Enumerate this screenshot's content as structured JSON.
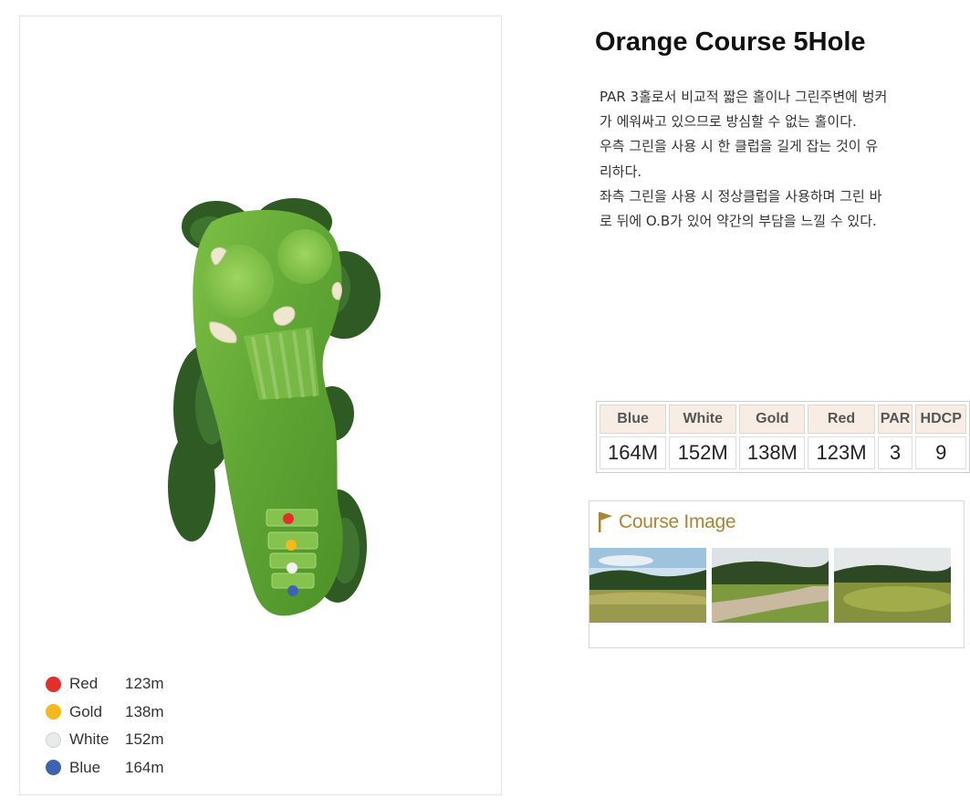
{
  "hole": {
    "title": "Orange Course 5Hole",
    "description": [
      "PAR 3홀로서 비교적 짧은 홀이나 그린주변에 벙커",
      "가 에워싸고 있으므로 방심할 수 없는 홀이다.",
      "우측 그린을 사용 시 한 클럽을 길게 잡는 것이 유",
      "리하다.",
      "좌측 그린을 사용 시 정상클럽을 사용하며 그린 바",
      "로 뒤에 O.B가 있어 약간의 부담을 느낄 수 있다."
    ]
  },
  "legend": [
    {
      "name": "Red",
      "distance": "123m",
      "color": "#e0302a"
    },
    {
      "name": "Gold",
      "distance": "138m",
      "color": "#f5b820"
    },
    {
      "name": "White",
      "distance": "152m",
      "color": "#e8ebeb"
    },
    {
      "name": "Blue",
      "distance": "164m",
      "color": "#3e63b0"
    }
  ],
  "scorecard": {
    "headers": [
      "Blue",
      "White",
      "Gold",
      "Red",
      "PAR",
      "HDCP"
    ],
    "values": [
      "164M",
      "152M",
      "138M",
      "123M",
      "3",
      "9"
    ]
  },
  "course_image": {
    "title": "Course Image",
    "icon": "flag-icon",
    "accent": "#a88535"
  },
  "colors": {
    "fairway": "#6fb23a",
    "green": "#8ccb4e",
    "trees": "#2f5a23",
    "header_bg": "#f8ede5"
  }
}
